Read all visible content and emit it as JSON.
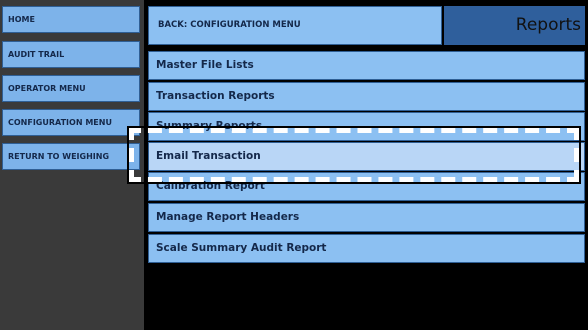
{
  "sidebar": {
    "items": [
      {
        "label": "HOME"
      },
      {
        "label": "AUDIT TRAIL"
      },
      {
        "label": "OPERATOR MENU"
      },
      {
        "label": "CONFIGURATION MENU"
      },
      {
        "label": "RETURN TO WEIGHING"
      }
    ]
  },
  "header": {
    "back_label": "BACK: CONFIGURATION MENU",
    "title": "Reports"
  },
  "menu": {
    "items": [
      {
        "label": "Master File Lists"
      },
      {
        "label": "Transaction Reports"
      },
      {
        "label": "Summary Reports"
      },
      {
        "label": "Email Transaction"
      },
      {
        "label": "Calibration Report"
      },
      {
        "label": "Manage Report Headers"
      },
      {
        "label": "Scale Summary Audit Report"
      }
    ]
  },
  "colors": {
    "button_bg": "#8cc0f2",
    "title_bar": "#2f5f9c",
    "highlight": "#ffffff"
  }
}
